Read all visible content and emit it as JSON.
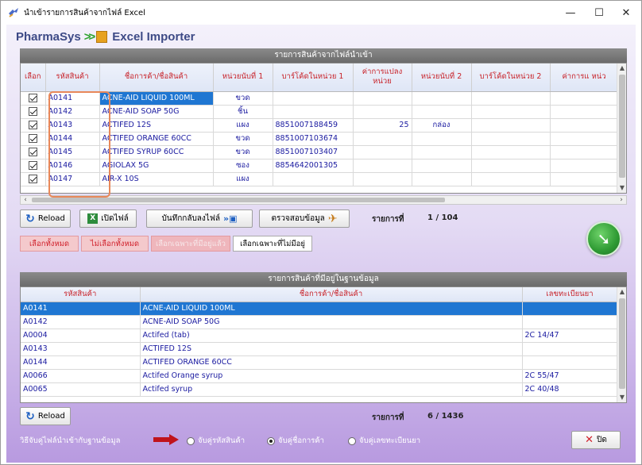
{
  "window": {
    "title": "นำเข้ารายการสินค้าจากไฟล์ Excel",
    "minimize_glyph": "—",
    "maximize_glyph": "☐",
    "close_glyph": "✕",
    "app_icon": "import-icon"
  },
  "brand": {
    "name": "PharmaSys",
    "arrows": ">>",
    "subtitle": "Excel Importer"
  },
  "import_panel": {
    "header": "รายการสินค้าจากไฟล์นำเข้า",
    "columns": [
      "เลือก",
      "รหัสสินค้า",
      "ชื่อการค้า/ชื่อสินค้า",
      "หน่วยนับที่ 1",
      "บาร์โค้ดในหน่วย 1",
      "ค่าการแปลงหน่วย",
      "หน่วยนับที่ 2",
      "บาร์โค้ดในหน่วย 2",
      "ค่าการแ หน่ว"
    ],
    "rows": [
      {
        "code": "A0141",
        "name": "ACNE-AID LIQUID 100ML",
        "unit1": "ขวด",
        "barcode1": "",
        "factor": "",
        "unit2": "",
        "barcode2": "",
        "extra": ""
      },
      {
        "code": "A0142",
        "name": "ACNE-AID SOAP 50G",
        "unit1": "ชิ้น",
        "barcode1": "",
        "factor": "",
        "unit2": "",
        "barcode2": "",
        "extra": ""
      },
      {
        "code": "A0143",
        "name": "ACTIFED 12S",
        "unit1": "แผง",
        "barcode1": "8851007188459",
        "factor": "25",
        "unit2": "กล่อง",
        "barcode2": "",
        "extra": ""
      },
      {
        "code": "A0144",
        "name": "ACTIFED ORANGE 60CC",
        "unit1": "ขวด",
        "barcode1": "8851007103674",
        "factor": "",
        "unit2": "",
        "barcode2": "",
        "extra": ""
      },
      {
        "code": "A0145",
        "name": "ACTIFED SYRUP 60CC",
        "unit1": "ขวด",
        "barcode1": "8851007103407",
        "factor": "",
        "unit2": "",
        "barcode2": "",
        "extra": ""
      },
      {
        "code": "A0146",
        "name": "AGIOLAX 5G",
        "unit1": "ซอง",
        "barcode1": "8854642001305",
        "factor": "",
        "unit2": "",
        "barcode2": "",
        "extra": ""
      },
      {
        "code": "A0147",
        "name": "AIR-X 10S",
        "unit1": "แผง",
        "barcode1": "",
        "factor": "",
        "unit2": "",
        "barcode2": "",
        "extra": ""
      }
    ],
    "selected_row": 0
  },
  "toolbar": {
    "reload": "Reload",
    "open_file": "เปิดไฟล์",
    "save_back": "บันทึกกลับลงไฟล์",
    "validate": "ตรวจสอบข้อมูล",
    "record_label": "รายการที่",
    "record_value": "1 / 104"
  },
  "select_buttons": {
    "select_all": "เลือกทั้งหมด",
    "deselect_all": "ไม่เลือกทั้งหมด",
    "select_existing": "เลือกเฉพาะที่มีอยู่แล้ว",
    "select_missing": "เลือกเฉพาะที่ไม่มีอยู่"
  },
  "db_panel": {
    "header": "รายการสินค้าที่มีอยู่ในฐานข้อมูล",
    "columns": [
      "รหัสสินค้า",
      "ชื่อการค้า/ชื่อสินค้า",
      "เลขทะเบียนยา"
    ],
    "rows": [
      {
        "code": "A0141",
        "name": "ACNE-AID LIQUID 100ML",
        "reg": ""
      },
      {
        "code": "A0142",
        "name": "ACNE-AID SOAP 50G",
        "reg": ""
      },
      {
        "code": "A0004",
        "name": "Actifed (tab)",
        "reg": "2C 14/47"
      },
      {
        "code": "A0143",
        "name": "ACTIFED 12S",
        "reg": ""
      },
      {
        "code": "A0144",
        "name": "ACTIFED ORANGE 60CC",
        "reg": ""
      },
      {
        "code": "A0066",
        "name": "Actifed Orange syrup",
        "reg": "2C 55/47"
      },
      {
        "code": "A0065",
        "name": "Actifed syrup",
        "reg": "2C 40/48"
      }
    ],
    "selected_row": 0,
    "reload": "Reload",
    "record_label": "รายการที่",
    "record_value": "6 / 1436"
  },
  "footer": {
    "match_label": "วิธีจับคู่ไฟล์นำเข้ากับฐานข้อมูล",
    "options": [
      "จับคู่รหัสสินค้า",
      "จับคู่ชื่อการค้า",
      "จับคู่เลขทะเบียนยา"
    ],
    "selected_option": 1,
    "close": "ปิด"
  }
}
